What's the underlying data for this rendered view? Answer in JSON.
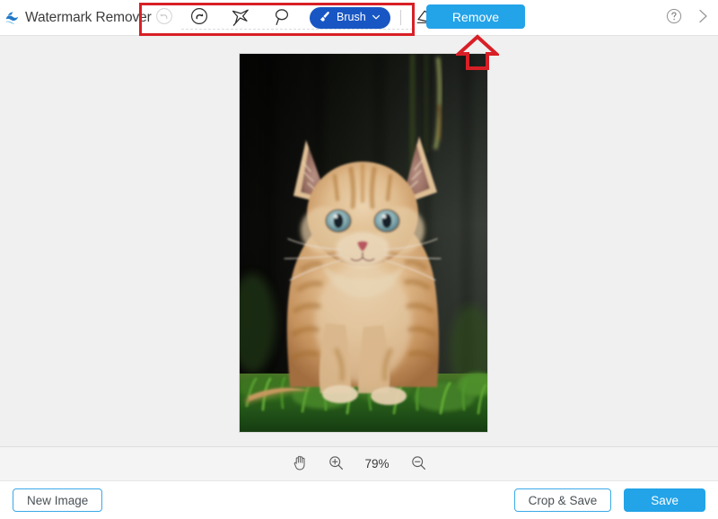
{
  "app": {
    "name": "Watermark Remover",
    "logo_icon": "wave-logo-icon",
    "accent_color": "#23a3e8",
    "brush_color": "#1856c4",
    "annotation_color": "#d81f26"
  },
  "toolbar": {
    "tools": [
      {
        "name": "undo",
        "icon": "undo-icon",
        "label": "Undo",
        "disabled": true
      },
      {
        "name": "redo",
        "icon": "redo-icon",
        "label": "Redo",
        "disabled": false
      },
      {
        "name": "polygon-select",
        "icon": "polygon-lasso-icon",
        "label": "Polygonal Lasso",
        "disabled": false
      },
      {
        "name": "lasso-select",
        "icon": "lasso-icon",
        "label": "Lasso",
        "disabled": false
      }
    ],
    "brush": {
      "label": "Brush",
      "icon": "brush-icon",
      "chevron": "chevron-down-icon"
    },
    "eraser": {
      "label": "Eraser",
      "icon": "eraser-icon"
    },
    "remove_label": "Remove"
  },
  "header_right": {
    "help": {
      "label": "?",
      "icon": "help-circle-icon"
    },
    "next": {
      "icon": "chevron-right-icon"
    }
  },
  "annotation": {
    "highlight_box": "toolbar-highlight",
    "arrow": "up-arrow-pointing-to-remove"
  },
  "canvas": {
    "image_alt": "orange tabby kitten sitting in green grass against dark wooden background"
  },
  "zoombar": {
    "pan": {
      "icon": "hand-pan-icon",
      "label": "Pan"
    },
    "zoom_in": {
      "icon": "zoom-in-icon",
      "label": "Zoom in"
    },
    "zoom_level": "79%",
    "zoom_out": {
      "icon": "zoom-out-icon",
      "label": "Zoom out"
    }
  },
  "footer": {
    "new_image_label": "New Image",
    "crop_save_label": "Crop & Save",
    "save_label": "Save"
  }
}
